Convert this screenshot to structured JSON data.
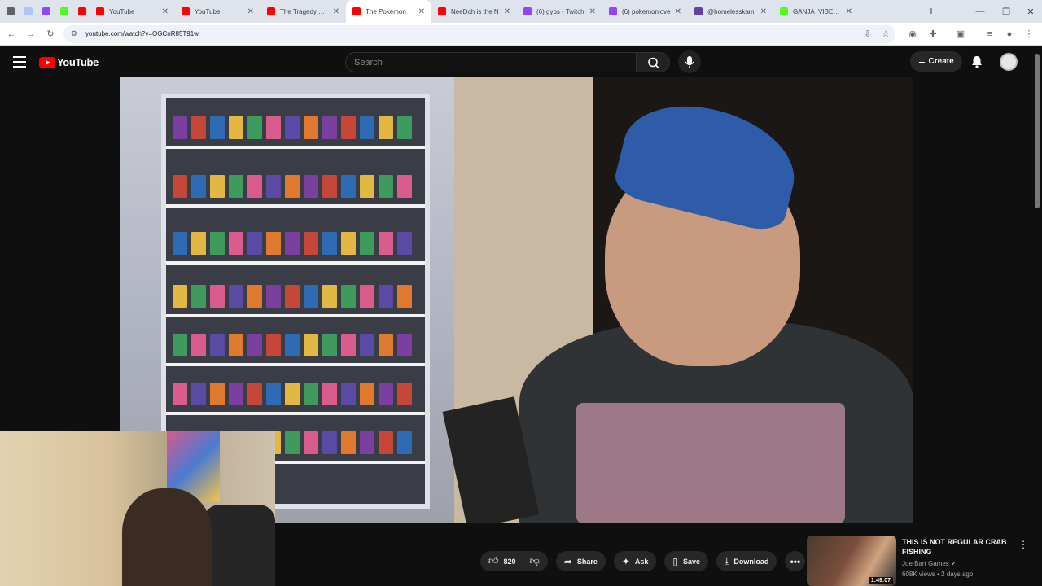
{
  "browser": {
    "tabs": [
      {
        "label": "",
        "color": "#5f6368",
        "active": false
      },
      {
        "label": "",
        "color": "#aec6f5",
        "active": false
      },
      {
        "label": "",
        "color": "#9146ff",
        "active": false
      },
      {
        "label": "",
        "color": "#53fc18",
        "active": false
      },
      {
        "label": "",
        "color": "#ff0000",
        "active": false
      },
      {
        "label": "YouTube",
        "color": "#ff0000",
        "active": false
      },
      {
        "label": "YouTube",
        "color": "#ff0000",
        "active": false
      },
      {
        "label": "The Tragedy Of N",
        "color": "#ff0000",
        "active": false
      },
      {
        "label": "The Pokémon",
        "color": "#ff0000",
        "active": true
      },
      {
        "label": "NeeDoh is the N",
        "color": "#ff0000",
        "active": false
      },
      {
        "label": "(6) gyps - Twitch",
        "color": "#9146ff",
        "active": false
      },
      {
        "label": "(6) pokemonlove",
        "color": "#9146ff",
        "active": false
      },
      {
        "label": "@homelesskam",
        "color": "#6441a5",
        "active": false
      },
      {
        "label": "GANJA_VIBES St",
        "color": "#53fc18",
        "active": false
      }
    ],
    "url": "youtube.com/watch?v=OGCnR85T91w"
  },
  "youtube": {
    "logo_text": "YouTube",
    "search_placeholder": "Search",
    "create_label": "Create"
  },
  "actions": {
    "like_count": "820",
    "share_label": "Share",
    "ask_label": "Ask",
    "save_label": "Save",
    "download_label": "Download"
  },
  "recommendation": {
    "title": "THIS IS NOT REGULAR CRAB FISHING",
    "channel": "Joe Bart Games",
    "meta": "608K views • 2 days ago",
    "duration": "1:49:07"
  },
  "colors": {
    "brand_red": "#ff0000",
    "background": "#0f0f0f",
    "pill": "#272727"
  }
}
